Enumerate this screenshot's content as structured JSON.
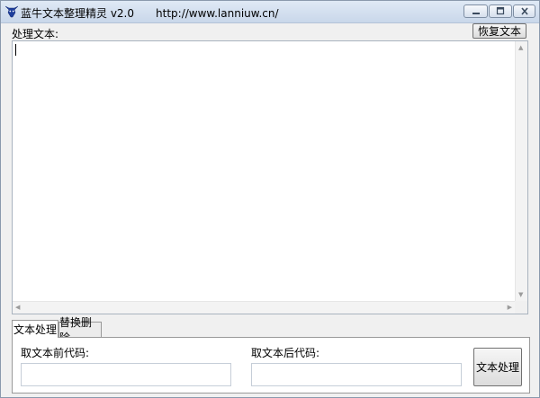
{
  "window": {
    "title": "蓝牛文本整理精灵 v2.0",
    "url": "http://www.lanniuw.cn/",
    "controls": {
      "minimize": "minimize-icon",
      "maximize": "maximize-icon",
      "close": "close-icon"
    }
  },
  "main": {
    "process_label": "处理文本:",
    "restore_button": "恢复文本",
    "textarea_value": ""
  },
  "tabs": [
    {
      "label": "文本处理",
      "active": true
    },
    {
      "label": "替换删除",
      "active": false
    }
  ],
  "panel": {
    "prefix_label": "取文本前代码:",
    "prefix_value": "",
    "suffix_label": "取文本后代码:",
    "suffix_value": "",
    "process_button": "文本处理"
  }
}
